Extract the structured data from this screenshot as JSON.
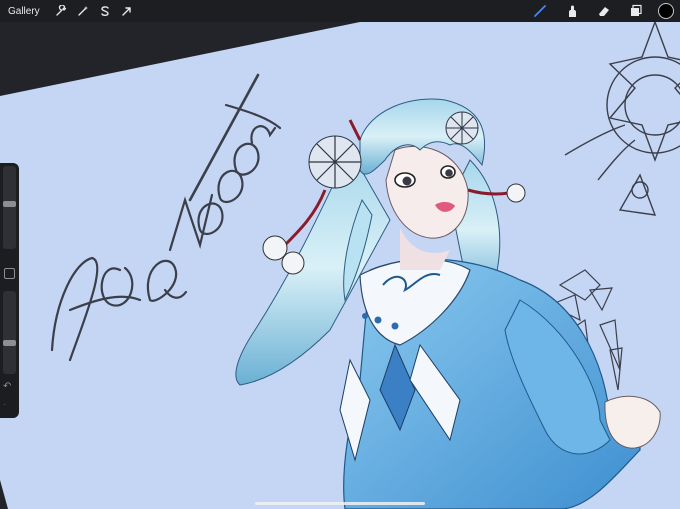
{
  "toolbar": {
    "gallery_label": "Gallery",
    "left_tools": [
      {
        "name": "actions",
        "icon": "wrench-icon"
      },
      {
        "name": "adjustments",
        "icon": "magic-wand-icon"
      },
      {
        "name": "selection",
        "icon": "selection-s-icon"
      },
      {
        "name": "transform",
        "icon": "arrow-cursor-icon"
      }
    ],
    "right_tools": [
      {
        "name": "brush",
        "icon": "brush-icon",
        "active": true
      },
      {
        "name": "smudge",
        "icon": "smudge-icon"
      },
      {
        "name": "eraser",
        "icon": "eraser-icon"
      },
      {
        "name": "layers",
        "icon": "layers-icon"
      }
    ],
    "current_color": "#000000",
    "accent_color": "#3a8bff"
  },
  "sidebar": {
    "brush_size_level": 0.55,
    "opacity_level": 0.36
  },
  "canvas": {
    "background_color": "#c5d5f4",
    "signature_text": "HaNoOona"
  }
}
